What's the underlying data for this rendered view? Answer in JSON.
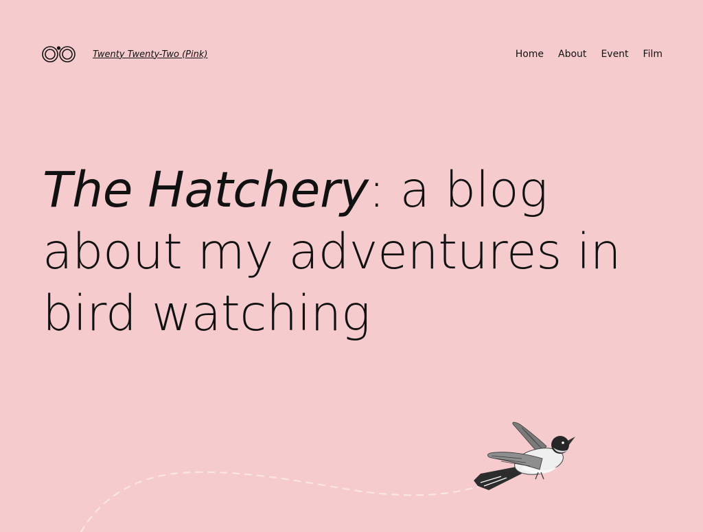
{
  "site": {
    "title": "Twenty Twenty-Two (Pink)"
  },
  "nav": {
    "items": [
      {
        "label": "Home"
      },
      {
        "label": "About"
      },
      {
        "label": "Event"
      },
      {
        "label": "Film"
      }
    ]
  },
  "hero": {
    "title_italic": "The Hatchery",
    "title_rest_line1": ": a blog",
    "title_line2": "about my adventures in",
    "title_line3": "bird watching"
  },
  "colors": {
    "background": "#f6cbcd",
    "text": "#111111",
    "flight_path": "#fbe6e6"
  },
  "icons": {
    "logo": "binoculars-logo-icon",
    "illustration": "bird-illustration"
  }
}
